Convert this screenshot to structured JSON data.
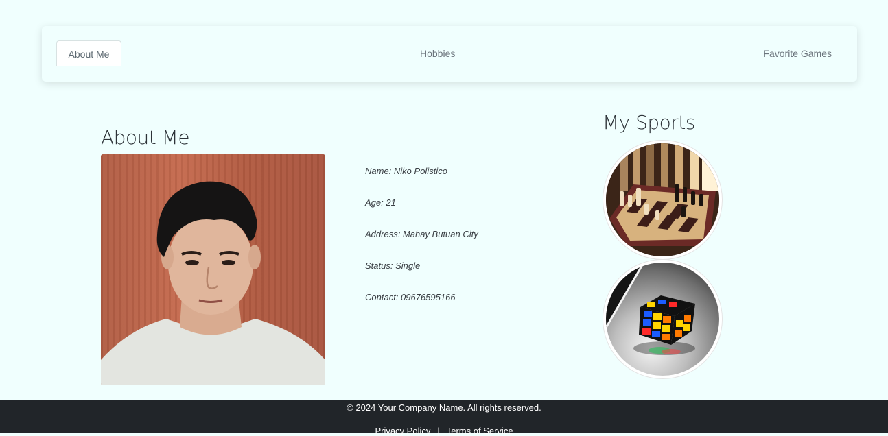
{
  "tabs": {
    "about": "About Me",
    "hobbies": "Hobbies",
    "games": "Favorite Games"
  },
  "about": {
    "title": "About Me",
    "photo_alt": "Profile photo",
    "details": [
      "Name: Niko Polistico",
      "Age: 21",
      "Address: Mahay Butuan City",
      "Status: Single",
      "Contact: 09676595166"
    ]
  },
  "sports": {
    "title": "My Sports",
    "items": [
      "Chess",
      "Rubik's Cube"
    ]
  },
  "footer": {
    "copyright": "© 2024 Your Company Name. All rights reserved.",
    "privacy": "Privacy Policy",
    "separator": "|",
    "terms": "Terms of Service"
  }
}
